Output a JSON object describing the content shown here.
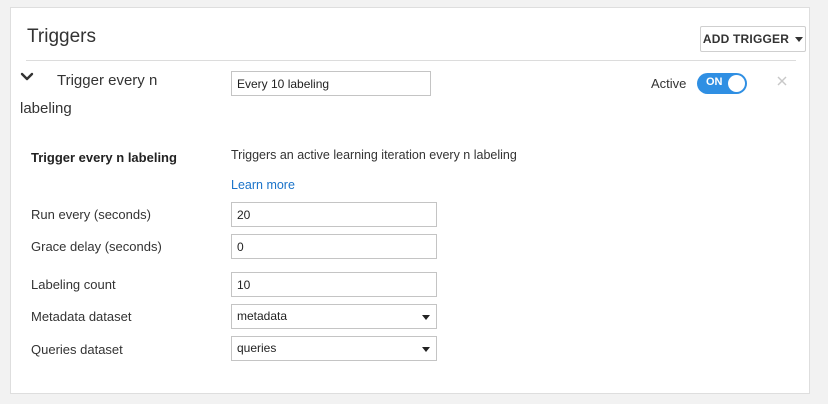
{
  "header": {
    "title": "Triggers",
    "add_trigger_label": "ADD TRIGGER",
    "add_trigger_icon": "caret-down-icon"
  },
  "trigger": {
    "name": "Trigger every n labeling",
    "name_input_value": "Every 10 labeling",
    "active_label": "Active",
    "toggle_state": "ON",
    "remove_icon": "close-icon",
    "collapse_icon": "chevron-down-icon",
    "section_title": "Trigger every n labeling",
    "description": "Triggers an active learning iteration every n labeling",
    "learn_more": "Learn more"
  },
  "fields": {
    "run_every": {
      "label": "Run every (seconds)",
      "value": "20"
    },
    "grace_delay": {
      "label": "Grace delay (seconds)",
      "value": "0"
    },
    "labeling_count": {
      "label": "Labeling count",
      "value": "10"
    },
    "metadata_dataset": {
      "label": "Metadata dataset",
      "value": "metadata"
    },
    "queries_dataset": {
      "label": "Queries dataset",
      "value": "queries"
    }
  },
  "colors": {
    "accent": "#2f8fe3",
    "link": "#1a73c9",
    "background": "#f2f2f2"
  }
}
